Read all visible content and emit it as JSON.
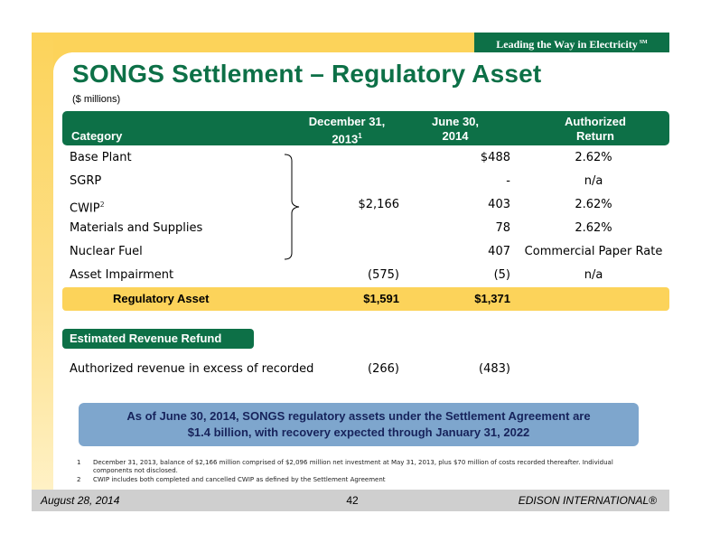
{
  "header": {
    "tagline": "Leading the Way in Electricity",
    "tagline_mark": "SM"
  },
  "title": "SONGS Settlement – Regulatory Asset",
  "subtitle": "($ millions)",
  "table": {
    "columns": {
      "category": "Category",
      "dec_line1": "December 31,",
      "dec_line2": "2013",
      "dec_sup": "1",
      "jun_line1": "June 30,",
      "jun_line2": "2014",
      "auth_line1": "Authorized",
      "auth_line2": "Return"
    },
    "rows": [
      {
        "label": "Base Plant",
        "sup": "",
        "dec": "",
        "jun": "$488",
        "auth": "2.62%"
      },
      {
        "label": "SGRP",
        "sup": "",
        "dec": "",
        "jun": "-",
        "auth": "n/a"
      },
      {
        "label": "CWIP",
        "sup": "2",
        "dec": "$2,166",
        "jun": "403",
        "auth": "2.62%"
      },
      {
        "label": "Materials and Supplies",
        "sup": "",
        "dec": "",
        "jun": "78",
        "auth": "2.62%"
      },
      {
        "label": "Nuclear Fuel",
        "sup": "",
        "dec": "",
        "jun": "407",
        "auth": "Commercial Paper Rate"
      },
      {
        "label": "Asset Impairment",
        "sup": "",
        "dec": "(575)",
        "jun": "(5)",
        "auth": "n/a"
      }
    ],
    "total": {
      "label": "Regulatory Asset",
      "dec": "$1,591",
      "jun": "$1,371"
    }
  },
  "refund": {
    "heading": "Estimated Revenue Refund",
    "row": {
      "label": "Authorized revenue in excess of recorded",
      "dec": "(266)",
      "jun": "(483)"
    }
  },
  "callout": {
    "line1": "As of June 30, 2014, SONGS regulatory assets under the Settlement Agreement are",
    "line2": "$1.4 billion, with recovery expected through January 31, 2022"
  },
  "footnotes": [
    {
      "num": "1",
      "text": "December 31, 2013, balance of $2,166 million comprised of $2,096 million net investment at May 31, 2013, plus $70 million of costs recorded thereafter. Individual components not disclosed."
    },
    {
      "num": "2",
      "text": "CWIP includes both completed and cancelled CWIP as defined by the Settlement Agreement"
    }
  ],
  "footer": {
    "date": "August 28, 2014",
    "page": "42",
    "brand": "EDISON INTERNATIONAL®"
  },
  "colors": {
    "green": "#0d7047",
    "yellow": "#fcd35a",
    "callout_blue": "#7ea6cd",
    "callout_text": "#17235b",
    "footer_gray": "#cfcfcf"
  }
}
